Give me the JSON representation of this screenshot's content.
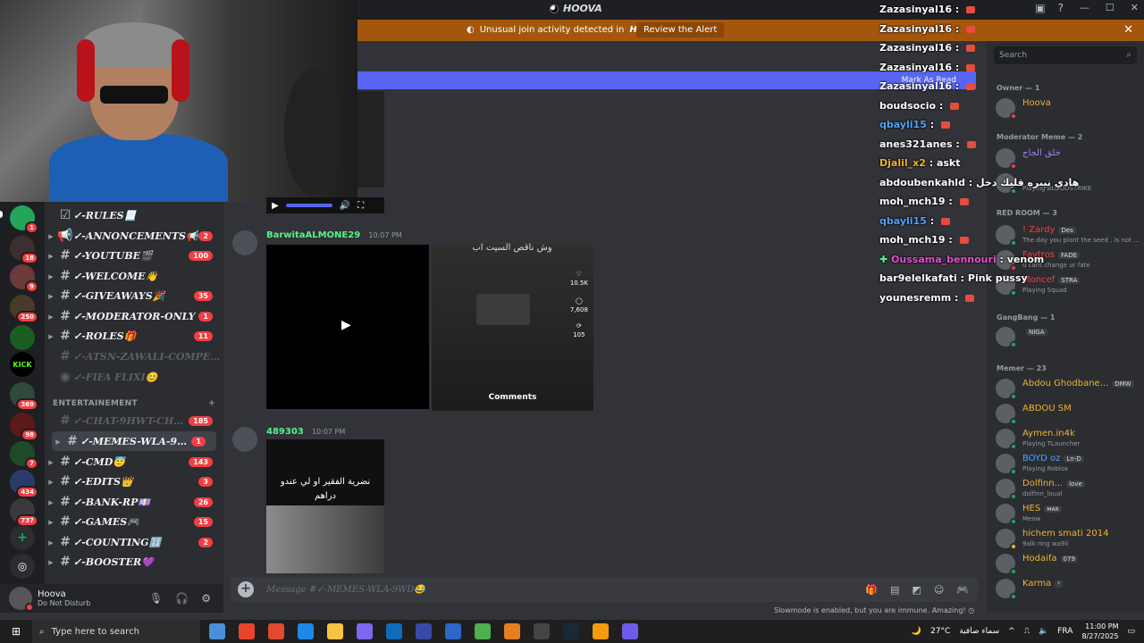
{
  "window": {
    "title": "HOOVA"
  },
  "alert": {
    "message": "Unusual join activity detected in",
    "server": "HOOVA",
    "review_label": "Review the Alert"
  },
  "mark_read": {
    "label": "Mark As Read"
  },
  "rail": {
    "servers": [
      {
        "label": "",
        "badge": "1"
      },
      {
        "label": "",
        "badge": "18"
      },
      {
        "label": "",
        "badge": "9"
      },
      {
        "label": "",
        "badge": "250"
      },
      {
        "label": "",
        "badge": ""
      },
      {
        "label": "KICK",
        "badge": ""
      },
      {
        "label": "",
        "badge": "369"
      },
      {
        "label": "",
        "badge": "98"
      },
      {
        "label": "",
        "badge": "7"
      },
      {
        "label": "",
        "badge": "434"
      },
      {
        "label": "",
        "badge": "737"
      }
    ]
  },
  "channels": {
    "items": [
      {
        "name": "✓-RULES📃",
        "count": ""
      },
      {
        "name": "✓-ANNONCEMENTS📢",
        "count": "2"
      },
      {
        "name": "✓-YOUTUBE🎬",
        "count": "100"
      },
      {
        "name": "✓-WELCOME👋",
        "count": ""
      },
      {
        "name": "✓-GIVEAWAYS🎉",
        "count": "35"
      },
      {
        "name": "✓-MODERATOR-ONLY",
        "count": "1"
      },
      {
        "name": "✓-ROLES🎁",
        "count": "11"
      },
      {
        "name": "✓-ATSN-ZAWALI-COMPETE...",
        "count": ""
      },
      {
        "name": "✓-FIFA FLIXI😊",
        "count": ""
      }
    ],
    "category": "ENTERTAINEMENT",
    "items2": [
      {
        "name": "✓-CHAT-9HWT-CHRGUI",
        "count": "185"
      },
      {
        "name": "✓-MEMES-WLA-9WD😂",
        "count": "1"
      },
      {
        "name": "✓-CMD😇",
        "count": "143"
      },
      {
        "name": "✓-EDITS👑",
        "count": "3"
      },
      {
        "name": "✓-BANK-RP💷",
        "count": "26"
      },
      {
        "name": "✓-GAMES🎮",
        "count": "15"
      },
      {
        "name": "✓-COUNTING🔢",
        "count": "2"
      },
      {
        "name": "✓-BOOSTER💜",
        "count": ""
      }
    ]
  },
  "user": {
    "name": "Hoova",
    "status": "Do Not Disturb"
  },
  "messages": [
    {
      "user": "BarwitaALMONE29",
      "time": "10:07 PM",
      "caption": "وش ناقص السيت اب",
      "comments": "Comments",
      "likes": "10.5K",
      "replies": "7,608",
      "shares": "105"
    },
    {
      "user": "489303",
      "time": "10:07 PM",
      "caption": "نضرية الفقير او لي عندو دراهم"
    }
  ],
  "composer": {
    "placeholder": "Message #✓-MEMES-WLA-9WD😂"
  },
  "slowmode": "Slowmode is enabled, but you are immune. Amazing!",
  "stream_chat": [
    {
      "user": "Zazasinyal16",
      "text": "",
      "color": "#ffffff"
    },
    {
      "user": "Zazasinyal16",
      "text": "",
      "color": "#ffffff"
    },
    {
      "user": "Zazasinyal16",
      "text": "",
      "color": "#ffffff"
    },
    {
      "user": "Zazasinyal16",
      "text": "",
      "color": "#ffffff"
    },
    {
      "user": "Zazasinyal16",
      "text": "",
      "color": "#ffffff"
    },
    {
      "user": "boudsocio",
      "text": "",
      "color": "#ffffff"
    },
    {
      "user": "qbayli15",
      "text": "",
      "color": "#4fa3ff"
    },
    {
      "user": "anes321anes",
      "text": "",
      "color": "#ffffff"
    },
    {
      "user": "Djalil_x2",
      "text": "askt",
      "color": "#f0b232"
    },
    {
      "user": "abdoubenkahld",
      "text": "هادي نيبره قليك دخل",
      "color": "#ffffff"
    },
    {
      "user": "moh_mch19",
      "text": "",
      "color": "#ffffff"
    },
    {
      "user": "qbayli15",
      "text": "",
      "color": "#4fa3ff"
    },
    {
      "user": "moh_mch19",
      "text": "",
      "color": "#ffffff"
    },
    {
      "user": "Oussama_bennouri",
      "text": "venom",
      "color": "#e94bd6"
    },
    {
      "user": "bar9elelkafati",
      "text": "Pink pussy",
      "color": "#ffffff"
    },
    {
      "user": "younesremm",
      "text": "",
      "color": "#ffffff"
    }
  ],
  "members": {
    "search_placeholder": "Search",
    "groups": [
      {
        "label": "Owner — 1"
      },
      {
        "label": "Moderator Meme — 2"
      },
      {
        "label": "RED ROOM — 3"
      },
      {
        "label": "GangBang — 1"
      },
      {
        "label": "Memer — 23"
      }
    ],
    "list": [
      {
        "name": "Hoova",
        "tag": "",
        "sub": "",
        "color": "#f0b232",
        "status": "#f23f43"
      },
      {
        "name": "خلق الجاج",
        "tag": "",
        "sub": "",
        "color": "#9b84ee",
        "status": "#f23f43"
      },
      {
        "name": "",
        "tag": "",
        "sub": "Playing BLOODSTRIKE",
        "color": "#9b84ee",
        "status": "#23a55a"
      },
      {
        "name": "! Zardy",
        "tag": "Des",
        "sub": "The day you plant the seed , is not ...",
        "color": "#f23f43",
        "status": "#23a55a"
      },
      {
        "name": "Favtros",
        "tag": "FADE",
        "sub": "u cant change ur fate",
        "color": "#f23f43",
        "status": "#f23f43"
      },
      {
        "name": "Moncef",
        "tag": "STRA",
        "sub": "Playing Squad",
        "color": "#f23f43",
        "status": "#23a55a"
      },
      {
        "name": "",
        "tag": "NIGA",
        "sub": "",
        "color": "#f0b232",
        "status": "#23a55a"
      },
      {
        "name": "Abdou Ghodbane...",
        "tag": "DMW",
        "sub": "",
        "color": "#f0b232",
        "status": "#23a55a"
      },
      {
        "name": "ABDOU SM",
        "tag": "",
        "sub": "",
        "color": "#f0b232",
        "status": "#23a55a"
      },
      {
        "name": "Aymen.in4k",
        "tag": "",
        "sub": "Playing TLauncher",
        "color": "#f0b232",
        "status": "#23a55a"
      },
      {
        "name": "BOYD oz",
        "tag": "Ln-D",
        "sub": "Playing Roblox",
        "color": "#4fa3ff",
        "status": "#23a55a"
      },
      {
        "name": "Dolfinn...",
        "tag": "love",
        "sub": "dolfinn_loual",
        "color": "#f0b232",
        "status": "#23a55a"
      },
      {
        "name": "HES",
        "tag": "ᴍᴀʀ",
        "sub": "Meow",
        "color": "#f0b232",
        "status": "#23a55a"
      },
      {
        "name": "hichem smati 2014",
        "tag": "",
        "sub": "9alk ring wa9il",
        "color": "#f0b232",
        "status": "#f0b232"
      },
      {
        "name": "Hodaifa",
        "tag": "079",
        "sub": "",
        "color": "#f0b232",
        "status": "#23a55a"
      },
      {
        "name": "Karma",
        "tag": "¹",
        "sub": "",
        "color": "#f0b232",
        "status": "#23a55a"
      }
    ]
  },
  "taskbar": {
    "search_placeholder": "Type here to search",
    "weather": "27°C",
    "weather_label": "سماء صافية",
    "lang": "FRA",
    "time": "11:00 PM",
    "date": "8/27/2025",
    "apps": [
      "#4a90d9",
      "#e7442b",
      "#e04a2e",
      "#1e88e5",
      "#f6c343",
      "#7b68ee",
      "#0f6cbd",
      "#3a49a8",
      "#2f66c8",
      "#4caf50",
      "#e67e22",
      "#444",
      "#1b2838",
      "#f39c12",
      "#6c5ce7"
    ]
  }
}
